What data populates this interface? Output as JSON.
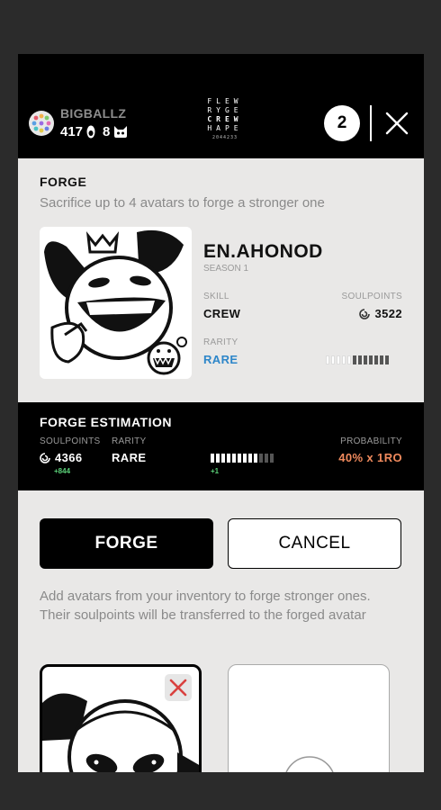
{
  "header": {
    "username": "BIGBALLZ",
    "stat_one": "417",
    "stat_two": "8",
    "logo_lines": [
      "FLEW",
      "RYGE",
      "CREW",
      "HAPE"
    ],
    "logo_small": "2044233",
    "count_badge": "2"
  },
  "forge": {
    "title": "FORGE",
    "subtitle": "Sacrifice up to 4 avatars to forge a stronger one",
    "avatar": {
      "name": "EN.AHONOD",
      "season": "SEASON 1",
      "skill_label": "SKILL",
      "skill_value": "CREW",
      "soulpoints_label": "SOULPOINTS",
      "soulpoints_value": "3522",
      "rarity_label": "RARITY",
      "rarity_value": "RARE",
      "rarity_level": {
        "filled": 5,
        "total": 12
      }
    }
  },
  "estimation": {
    "title": "FORGE ESTIMATION",
    "soulpoints_label": "SOULPOINTS",
    "soulpoints_value": "4366",
    "soulpoints_delta": "+844",
    "rarity_label": "RARITY",
    "rarity_value": "RARE",
    "rarity_delta": "+1",
    "rarity_level": {
      "filled": 9,
      "total": 12
    },
    "probability_label": "PROBABILITY",
    "probability_value": "40% x 1RO"
  },
  "actions": {
    "forge_label": "FORGE",
    "cancel_label": "CANCEL"
  },
  "info_text": "Add avatars from your inventory to forge stronger ones. Their soulpoints will be transferred to the forged avatar",
  "colors": {
    "rare": "#2d86c9",
    "probability": "#f08a5d",
    "delta": "#5cd37a",
    "remove": "#d9413f"
  },
  "icons": [
    "globe-icon",
    "ape-head-icon",
    "cat-head-icon",
    "close-icon",
    "soulpoints-icon",
    "remove-icon"
  ]
}
